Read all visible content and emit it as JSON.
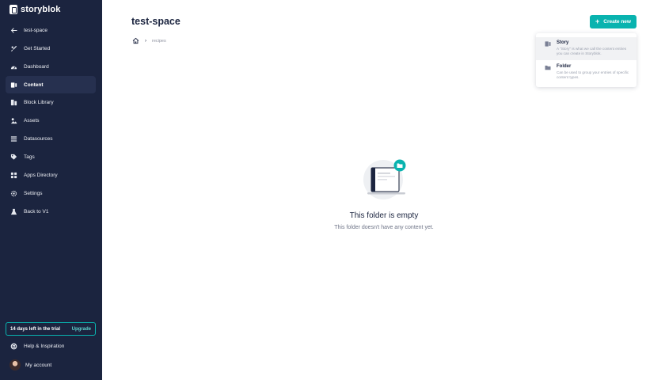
{
  "sidebar": {
    "logo_text": "storyblok",
    "items": [
      {
        "label": "test-space",
        "icon": "arrow-left-icon"
      },
      {
        "label": "Get Started",
        "icon": "rocket-icon"
      },
      {
        "label": "Dashboard",
        "icon": "gauge-icon"
      },
      {
        "label": "Content",
        "icon": "content-icon",
        "active": true
      },
      {
        "label": "Block Library",
        "icon": "blocks-icon"
      },
      {
        "label": "Assets",
        "icon": "assets-icon"
      },
      {
        "label": "Datasources",
        "icon": "list-icon"
      },
      {
        "label": "Tags",
        "icon": "tag-icon"
      },
      {
        "label": "Apps Directory",
        "icon": "apps-icon"
      },
      {
        "label": "Settings",
        "icon": "gear-icon"
      },
      {
        "label": "Back to V1",
        "icon": "flask-icon"
      }
    ],
    "trial_text": "14 days left in the trial",
    "upgrade_label": "Upgrade",
    "help_label": "Help & Inspiration",
    "account_label": "My account"
  },
  "main": {
    "title": "test-space",
    "breadcrumb": {
      "home_icon": "home-icon",
      "current": "recipes"
    },
    "create_button": {
      "label": "Create new",
      "icon": "plus-icon"
    },
    "dropdown": [
      {
        "title": "Story",
        "description": "A \"Story\" is what we call the content entries you can create in Storyblok.",
        "icon": "story-icon"
      },
      {
        "title": "Folder",
        "description": "Can be used to group your entries of specific content types.",
        "icon": "folder-icon"
      }
    ],
    "empty_state": {
      "title": "This folder is empty",
      "subtitle": "This folder doesn't have any content yet."
    }
  },
  "colors": {
    "sidebar_bg": "#1b243f",
    "accent": "#09b3af",
    "text_dark": "#1b243f"
  }
}
